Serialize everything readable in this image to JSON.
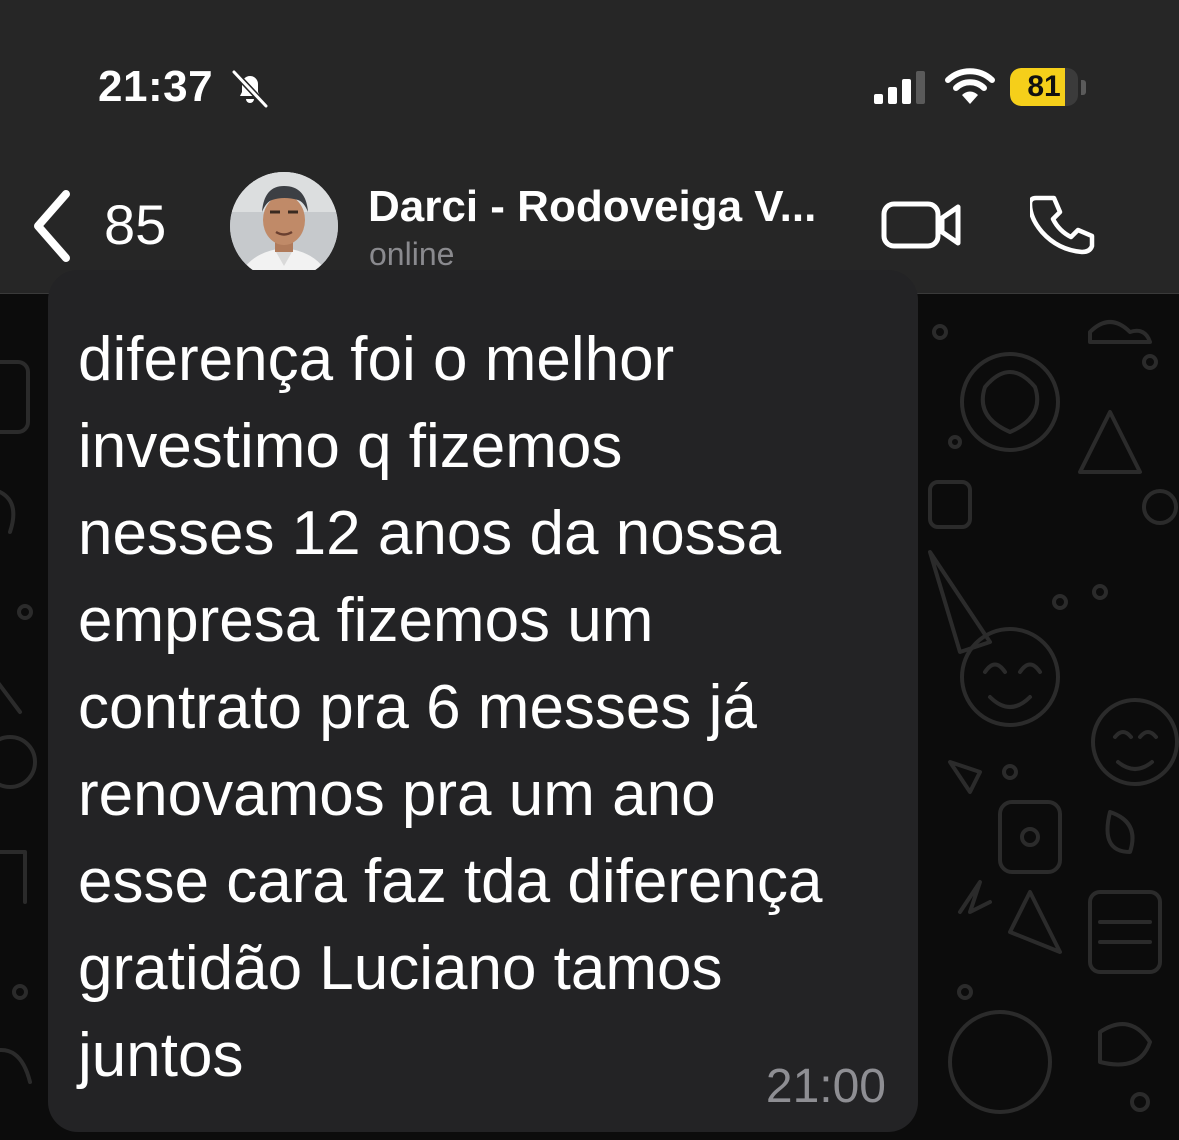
{
  "status_bar": {
    "time": "21:37",
    "mute_icon": "bell-slash-icon",
    "signal_icon": "cellular-signal-icon",
    "wifi_icon": "wifi-icon",
    "battery_level": "81",
    "battery_fraction": 0.81,
    "battery_color": "#f5cf1a"
  },
  "nav": {
    "back_icon": "chevron-left-icon",
    "back_count": "85",
    "contact_name": "Darci - Rodoveiga V...",
    "contact_status": "online",
    "video_call_icon": "video-camera-icon",
    "voice_call_icon": "phone-icon"
  },
  "message": {
    "lines": [
      "diferença foi o melhor",
      "investimo q fizemos",
      "nesses 12 anos da nossa",
      "empresa fizemos um",
      "contrato pra 6 messes já",
      "renovamos pra um ano",
      "esse cara faz tda diferença",
      "gratidão Luciano tamos",
      "juntos"
    ],
    "time": "21:00",
    "bubble_color": "#232325"
  }
}
